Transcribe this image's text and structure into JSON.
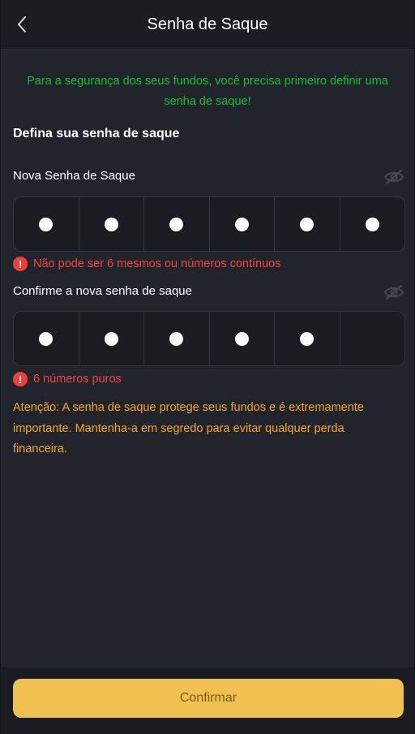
{
  "header": {
    "title": "Senha de Saque",
    "back_icon": "chevron-left-icon"
  },
  "notice": "Para a segurança dos seus fundos, você precisa primeiro definir uma senha de saque!",
  "section_title": "Defina sua senha de saque",
  "new_password": {
    "label": "Nova Senha de Saque",
    "toggle_icon": "eye-off-icon",
    "digits_entered": 6,
    "digits_total": 6,
    "error": "Não pode ser 6 mesmos ou números contínuos"
  },
  "confirm_password": {
    "label": "Confirme a nova senha de saque",
    "toggle_icon": "eye-off-icon",
    "digits_entered": 5,
    "digits_total": 6,
    "error": "6 números puros"
  },
  "warning": "Atenção: A senha de saque protege seus fundos e é extremamente importante. Mantenha-a em segredo para evitar qualquer perda financeira.",
  "footer": {
    "confirm_label": "Confirmar"
  },
  "colors": {
    "notice": "#10c02e",
    "error": "#f0443e",
    "warning": "#f6a623",
    "button": "#f0c050"
  }
}
